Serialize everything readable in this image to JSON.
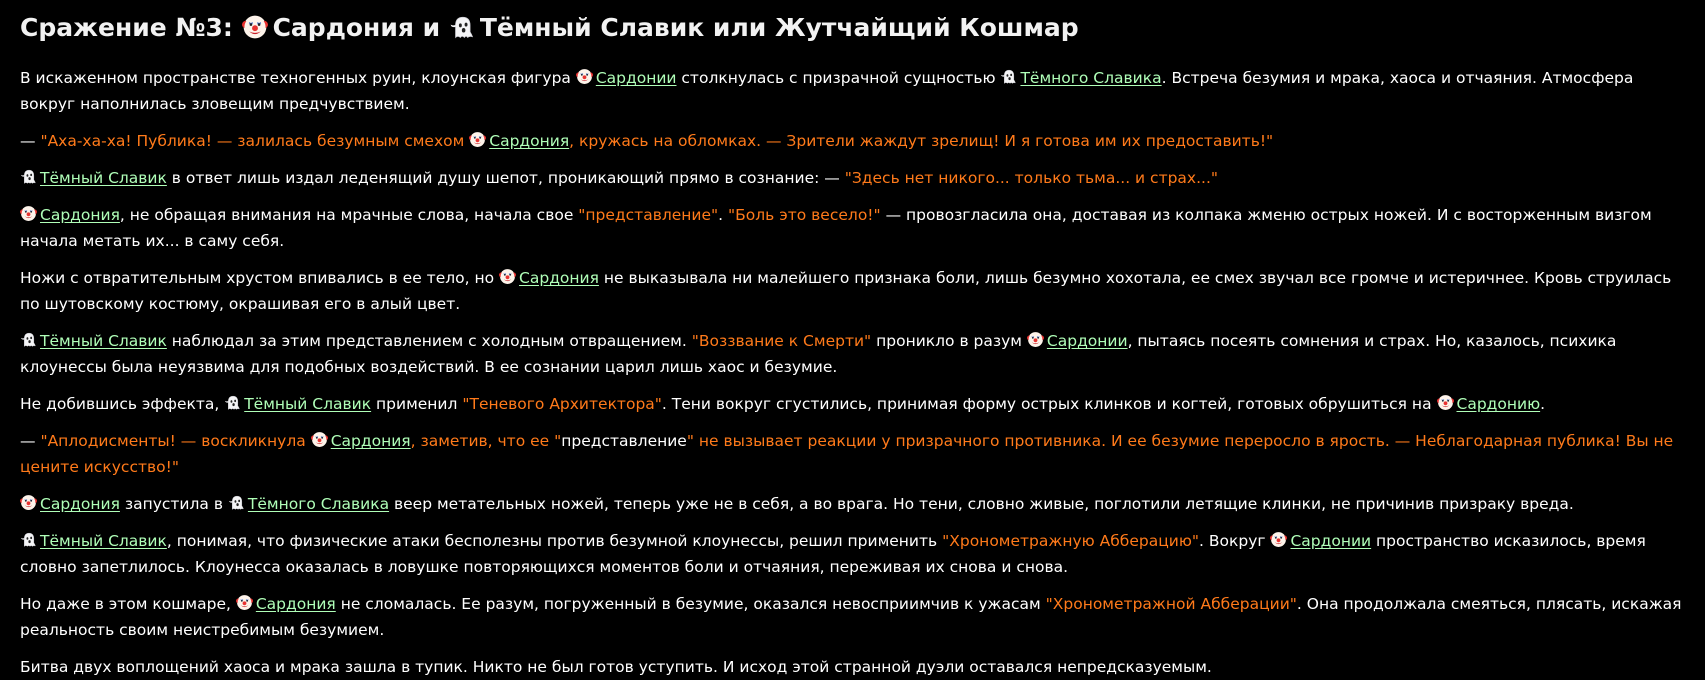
{
  "title": {
    "prefix": "Сражение №3: ",
    "name1": "Сардония",
    "middle": " и ",
    "name2": "Тёмный Славик или Жутчайщий Кошмар"
  },
  "icons": {
    "clown": "clown-face-icon",
    "ghost": "ghost-icon"
  },
  "colors": {
    "background": "#000000",
    "text": "#ffffff",
    "quote": "#ff7a1a",
    "link": "#b0ffb8"
  },
  "paragraphs": [
    [
      {
        "t": "text",
        "v": "В искаженном пространстве техногенных руин, клоунская фигура "
      },
      {
        "t": "link",
        "icon": "clown",
        "v": "Сардонии"
      },
      {
        "t": "text",
        "v": " столкнулась с призрачной сущностью "
      },
      {
        "t": "link",
        "icon": "ghost",
        "v": "Тёмного Славика"
      },
      {
        "t": "text",
        "v": ". Встреча безумия и мрака, хаоса и отчаяния. Атмосфера вокруг наполнилась зловещим предчувствием."
      }
    ],
    [
      {
        "t": "text",
        "v": "— "
      },
      {
        "t": "quote",
        "v": "\"Аха-ха-ха! Публика! — залилась безумным смехом "
      },
      {
        "t": "link",
        "icon": "clown",
        "v": "Сардония"
      },
      {
        "t": "quote",
        "v": ", кружась на обломках. — Зрители жаждут зрелищ! И я готова им их предоставить!\""
      }
    ],
    [
      {
        "t": "link",
        "icon": "ghost",
        "v": "Тёмный Славик"
      },
      {
        "t": "text",
        "v": " в ответ лишь издал леденящий душу шепот, проникающий прямо в сознание: — "
      },
      {
        "t": "quote",
        "v": "\"Здесь нет никого... только тьма... и страх...\""
      }
    ],
    [
      {
        "t": "link",
        "icon": "clown",
        "v": "Сардония"
      },
      {
        "t": "text",
        "v": ", не обращая внимания на мрачные слова, начала свое "
      },
      {
        "t": "quote",
        "v": "\"представление\""
      },
      {
        "t": "text",
        "v": ". "
      },
      {
        "t": "quote",
        "v": "\"Боль это весело!\""
      },
      {
        "t": "text",
        "v": " — провозгласила она, доставая из колпака жменю острых ножей. И с восторженным визгом начала метать их... в саму себя."
      }
    ],
    [
      {
        "t": "text",
        "v": "Ножи с отвратительным хрустом впивались в ее тело, но "
      },
      {
        "t": "link",
        "icon": "clown",
        "v": "Сардония"
      },
      {
        "t": "text",
        "v": " не выказывала ни малейшего признака боли, лишь безумно хохотала, ее смех звучал все громче и истеричнее. Кровь струилась по шутовскому костюму, окрашивая его в алый цвет."
      }
    ],
    [
      {
        "t": "link",
        "icon": "ghost",
        "v": "Тёмный Славик"
      },
      {
        "t": "text",
        "v": " наблюдал за этим представлением с холодным отвращением. "
      },
      {
        "t": "quote",
        "v": "\"Воззвание к Смерти\""
      },
      {
        "t": "text",
        "v": " проникло в разум "
      },
      {
        "t": "link",
        "icon": "clown",
        "v": "Сардонии"
      },
      {
        "t": "text",
        "v": ", пытаясь посеять сомнения и страх. Но, казалось, психика клоунессы была неуязвима для подобных воздействий. В ее сознании царил лишь хаос и безумие."
      }
    ],
    [
      {
        "t": "text",
        "v": "Не добившись эффекта, "
      },
      {
        "t": "link",
        "icon": "ghost",
        "v": "Тёмный Славик"
      },
      {
        "t": "text",
        "v": " применил "
      },
      {
        "t": "quote",
        "v": "\"Теневого Архитектора\""
      },
      {
        "t": "text",
        "v": ". Тени вокруг сгустились, принимая форму острых клинков и когтей, готовых обрушиться на "
      },
      {
        "t": "link",
        "icon": "clown",
        "v": "Сардонию"
      },
      {
        "t": "text",
        "v": "."
      }
    ],
    [
      {
        "t": "text",
        "v": "— "
      },
      {
        "t": "quote",
        "v": "\"Аплодисменты! — воскликнула "
      },
      {
        "t": "link",
        "icon": "clown",
        "v": "Сардония"
      },
      {
        "t": "quote",
        "v": ", заметив, что ее \""
      },
      {
        "t": "text",
        "v": "представление"
      },
      {
        "t": "quote",
        "v": "\" не вызывает реакции у призрачного противника. И ее безумие переросло в ярость. — Неблагодарная публика! Вы не цените искусство!\""
      }
    ],
    [
      {
        "t": "link",
        "icon": "clown",
        "v": "Сардония"
      },
      {
        "t": "text",
        "v": " запустила в "
      },
      {
        "t": "link",
        "icon": "ghost",
        "v": "Тёмного Славика"
      },
      {
        "t": "text",
        "v": " веер метательных ножей, теперь уже не в себя, а во врага. Но тени, словно живые, поглотили летящие клинки, не причинив призраку вреда."
      }
    ],
    [
      {
        "t": "link",
        "icon": "ghost",
        "v": "Тёмный Славик"
      },
      {
        "t": "text",
        "v": ", понимая, что физические атаки бесполезны против безумной клоунессы, решил применить "
      },
      {
        "t": "quote",
        "v": "\"Хронометражную Абберацию\""
      },
      {
        "t": "text",
        "v": ". Вокруг "
      },
      {
        "t": "link",
        "icon": "clown",
        "v": "Сардонии"
      },
      {
        "t": "text",
        "v": " пространство исказилось, время словно запетлилось. Клоунесса оказалась в ловушке повторяющихся моментов боли и отчаяния, переживая их снова и снова."
      }
    ],
    [
      {
        "t": "text",
        "v": "Но даже в этом кошмаре, "
      },
      {
        "t": "link",
        "icon": "clown",
        "v": "Сардония"
      },
      {
        "t": "text",
        "v": " не сломалась. Ее разум, погруженный в безумие, оказался невосприимчив к ужасам "
      },
      {
        "t": "quote",
        "v": "\"Хронометражной Абберации\""
      },
      {
        "t": "text",
        "v": ". Она продолжала смеяться, плясать, искажая реальность своим неистребимым безумием."
      }
    ],
    [
      {
        "t": "text",
        "v": "Битва двух воплощений хаоса и мрака зашла в тупик. Никто не был готов уступить. И исход этой странной дуэли оставался непредсказуемым."
      }
    ]
  ]
}
